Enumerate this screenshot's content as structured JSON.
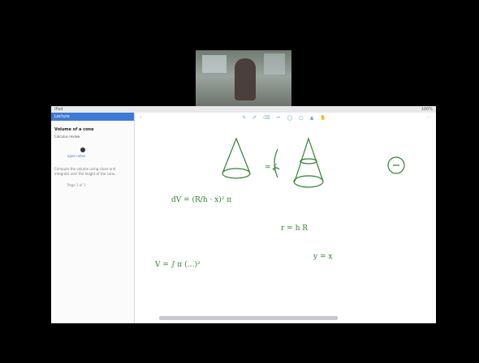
{
  "camera": {
    "label": "Presenter webcam"
  },
  "topbar": {
    "left": "iPad",
    "right": "100%"
  },
  "sidebar": {
    "header": "Lecture",
    "title": "Volume of a cone",
    "subtitle": "Calculus review",
    "link": "open notes",
    "paragraph": "Compute the volume using slices and integrate over the height of the cone.",
    "footer": "Page 1 of 1"
  },
  "toolbar": {
    "left": "‹",
    "tools": "✎ ✐ ⌫ ✂ ◯ ▢ ▲ ✋",
    "right": "⋯"
  },
  "whiteboard": {
    "eq1": "= ∫",
    "eq2": "dV = (R/h · x)² π",
    "eq3": "r = h R",
    "eq4": "y = x",
    "eq5": "V = ∫ π (…)²"
  },
  "colors": {
    "ink": "#2f7f2f",
    "accent": "#3d7ad6"
  }
}
